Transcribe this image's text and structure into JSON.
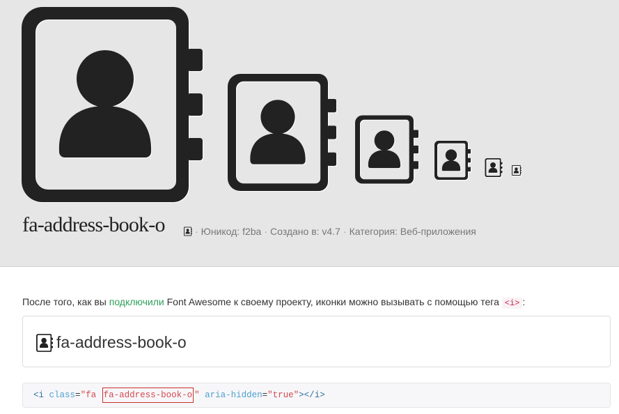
{
  "page": {
    "icon_name": "address-book-o-icon",
    "icon_color": "#222222",
    "accent_link_color": "#2e9e5b"
  },
  "hero": {
    "title": "fa-address-book-o",
    "meta": {
      "unicode_label": "Юникод: f2ba",
      "created_label": "Создано в: v4.7",
      "category_label": "Категория: Веб-приложения",
      "separator": "·"
    }
  },
  "intro": {
    "text_before": "После того, как вы ",
    "link_text": "подключили",
    "text_after": " Font Awesome к своему проекту, иконки можно вызывать с помощью тега ",
    "tag_code": "<i>",
    "text_end": ":"
  },
  "demo": {
    "label": "fa-address-book-o"
  },
  "code": {
    "open_bracket": "<",
    "tag": "i",
    "class_attr": " class",
    "eq1": "=",
    "class_value_start": "\"fa ",
    "class_value_highlight": "fa-address-book-o",
    "class_value_end": "\"",
    "aria_attr": " aria-hidden",
    "eq2": "=",
    "aria_value": "\"true\"",
    "close_open": "></",
    "close_tag": "i",
    "close_end": ">"
  }
}
